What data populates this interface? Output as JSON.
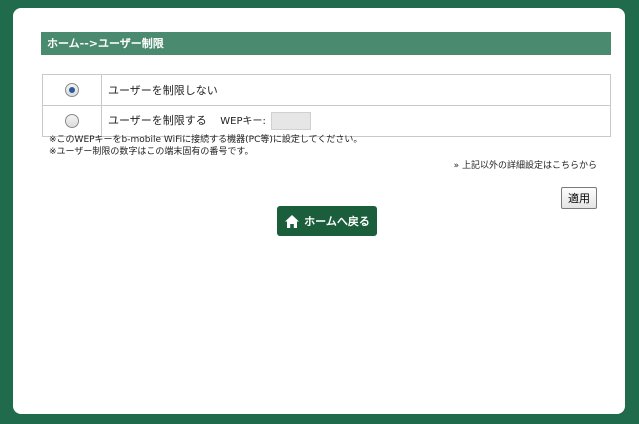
{
  "header": {
    "title": "ホーム-->ユーザー制限"
  },
  "options": [
    {
      "label": "ユーザーを制限しない",
      "selected": true
    },
    {
      "label": "ユーザーを制限する",
      "selected": false,
      "wep_label": "WEPキー:",
      "wep_value": ""
    }
  ],
  "notes": [
    "※このWEPキーをb-mobile WiFiに接続する機器(PC等)に設定してください。",
    "※ユーザー制限の数字はこの端末固有の番号です。"
  ],
  "detail_link": "» 上記以外の詳細設定はこちらから",
  "apply_label": "適用",
  "home_button": {
    "label": "ホームへ戻る",
    "icon": "home-icon"
  },
  "colors": {
    "background": "#1f6b4b",
    "header_bar": "#4a8a6e",
    "home_button": "#1b5e3c"
  }
}
